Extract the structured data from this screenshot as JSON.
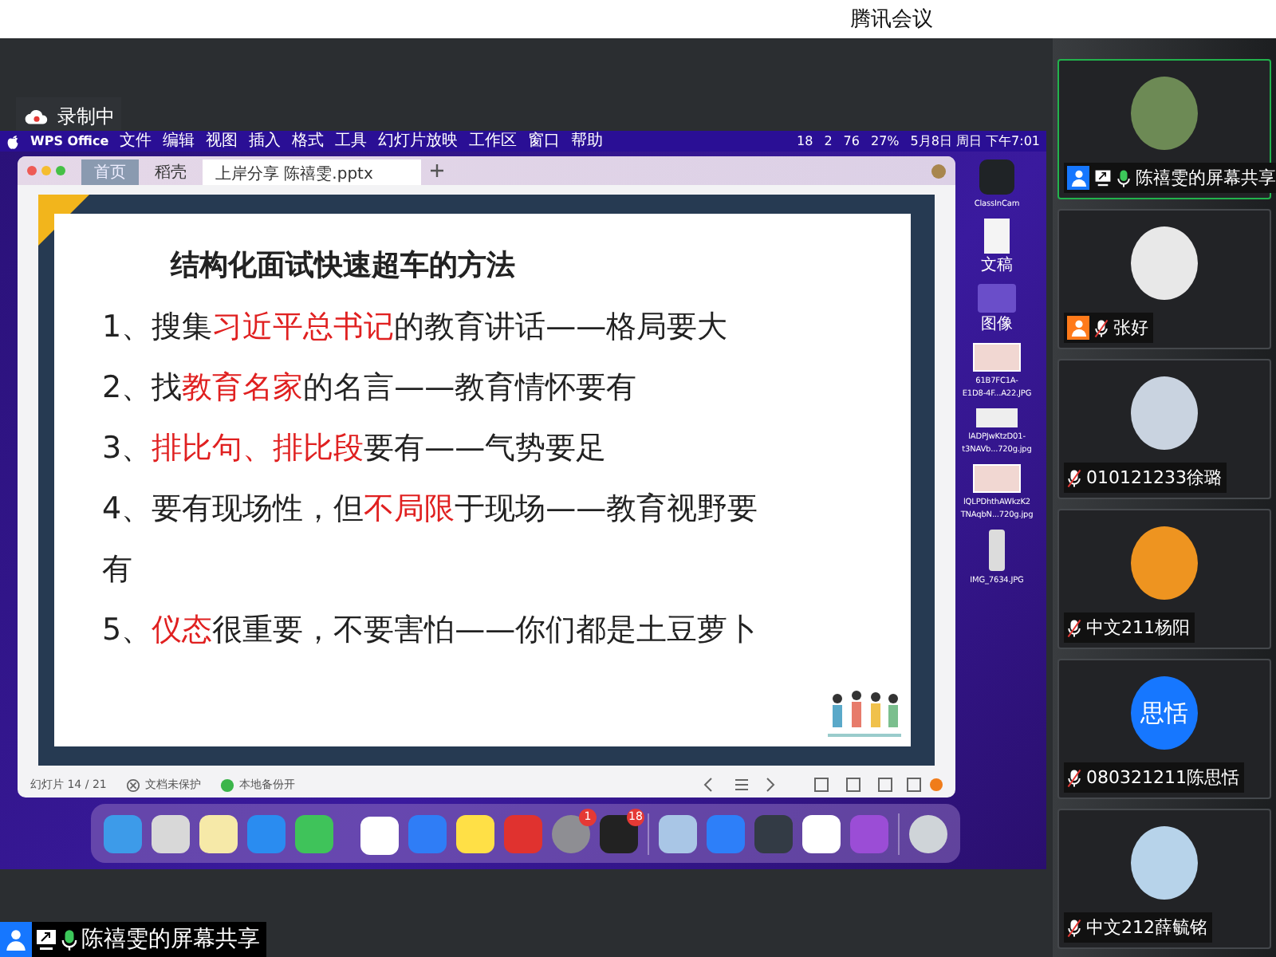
{
  "app_title": "腾讯会议",
  "recording": {
    "label": "录制中"
  },
  "menu_bar": {
    "items": [
      "WPS Office",
      "文件",
      "编辑",
      "视图",
      "插入",
      "格式",
      "工具",
      "幻灯片放映",
      "工作区",
      "窗口",
      "帮助"
    ],
    "status": [
      "18",
      "2",
      "76",
      "27%"
    ],
    "clock": "5月8日 周日 下午7:01"
  },
  "wps": {
    "tabs": [
      {
        "label": "首页",
        "kind": "home",
        "selected": false
      },
      {
        "label": "稻壳",
        "kind": "docer",
        "selected": false
      },
      {
        "label": "上岸分享 陈禧雯.pptx",
        "kind": "file",
        "selected": true
      }
    ],
    "slide": {
      "title": "结构化面试快速超车的方法",
      "points": [
        [
          {
            "text": "1、搜集",
            "highlight": false
          },
          {
            "text": "习近平总书记",
            "highlight": true
          },
          {
            "text": "的教育讲话——格局要大",
            "highlight": false
          }
        ],
        [
          {
            "text": "2、找",
            "highlight": false
          },
          {
            "text": "教育名家",
            "highlight": true
          },
          {
            "text": "的名言——教育情怀要有",
            "highlight": false
          }
        ],
        [
          {
            "text": "3、",
            "highlight": false
          },
          {
            "text": "排比句、排比段",
            "highlight": true
          },
          {
            "text": "要有——气势要足",
            "highlight": false
          }
        ],
        [
          {
            "text": "4、要有现场性，但",
            "highlight": false
          },
          {
            "text": "不局限",
            "highlight": true
          },
          {
            "text": "于现场——教育视野要有",
            "highlight": false
          }
        ],
        [
          {
            "text": "5、",
            "highlight": false
          },
          {
            "text": "仪态",
            "highlight": true
          },
          {
            "text": "很重要，不要害怕——你们都是土豆萝卜",
            "highlight": false
          }
        ]
      ]
    },
    "status_bar": {
      "slide_counter": "幻灯片 14 / 21",
      "protection": "文档未保护",
      "backup": "本地备份开"
    }
  },
  "desktop_files": [
    {
      "kind": "app",
      "lines": [
        "ClassInCam"
      ]
    },
    {
      "kind": "document",
      "lines": [
        "文稿"
      ]
    },
    {
      "kind": "folder",
      "lines": [
        "图像"
      ]
    },
    {
      "kind": "photo",
      "lines": [
        "61B7FC1A-",
        "E1D8-4F...A22.JPG"
      ]
    },
    {
      "kind": "strip",
      "lines": [
        "lADPJwKtzD01-",
        "t3NAVb...720g.jpg"
      ]
    },
    {
      "kind": "photo",
      "lines": [
        "lQLPDhthAWkzK2",
        "TNAqbN...720g.jpg"
      ]
    },
    {
      "kind": "phone",
      "lines": [
        "IMG_7634.JPG"
      ]
    }
  ],
  "dock": [
    {
      "kind": "finder"
    },
    {
      "kind": "launchpad"
    },
    {
      "kind": "notes"
    },
    {
      "kind": "safari"
    },
    {
      "kind": "wechat"
    },
    {
      "kind": "wps"
    },
    {
      "kind": "feishu"
    },
    {
      "kind": "music"
    },
    {
      "kind": "netease"
    },
    {
      "kind": "settings",
      "badge": "1"
    },
    {
      "kind": "qq",
      "badge": "18"
    },
    {
      "kind": "divider"
    },
    {
      "kind": "preview"
    },
    {
      "kind": "lark"
    },
    {
      "kind": "quicktime"
    },
    {
      "kind": "baidu"
    },
    {
      "kind": "podcasts"
    },
    {
      "kind": "divider"
    },
    {
      "kind": "trash"
    }
  ],
  "participants": [
    {
      "name": "陈禧雯的屏幕共享",
      "selected": true,
      "role_badge": {
        "color": "#1677ff"
      },
      "sharing": true,
      "mic_on": true,
      "avatar": {
        "kind": "picture",
        "color": "#6d8a55"
      }
    },
    {
      "name": "张好",
      "selected": false,
      "role_badge": {
        "color": "#ff7a1a"
      },
      "sharing": false,
      "mic_on": false,
      "avatar": {
        "kind": "picture",
        "color": "#e8e8e8"
      }
    },
    {
      "name": "010121233徐璐",
      "selected": false,
      "sharing": false,
      "mic_on": false,
      "avatar": {
        "kind": "picture",
        "color": "#c9d3e0"
      }
    },
    {
      "name": "中文211杨阳",
      "selected": false,
      "sharing": false,
      "mic_on": false,
      "avatar": {
        "kind": "picture",
        "color": "#ee9420"
      }
    },
    {
      "name": "080321211陈思恬",
      "selected": false,
      "sharing": false,
      "mic_on": false,
      "avatar": {
        "kind": "initials",
        "text": "思恬",
        "color": "#1677ff"
      }
    },
    {
      "name": "中文212薛毓铭",
      "selected": false,
      "sharing": false,
      "mic_on": false,
      "avatar": {
        "kind": "picture",
        "color": "#b7d3ea"
      }
    }
  ],
  "share_label": {
    "name": "陈禧雯的屏幕共享",
    "role_badge": {
      "color": "#1677ff"
    },
    "sharing": true,
    "mic_on": true
  }
}
